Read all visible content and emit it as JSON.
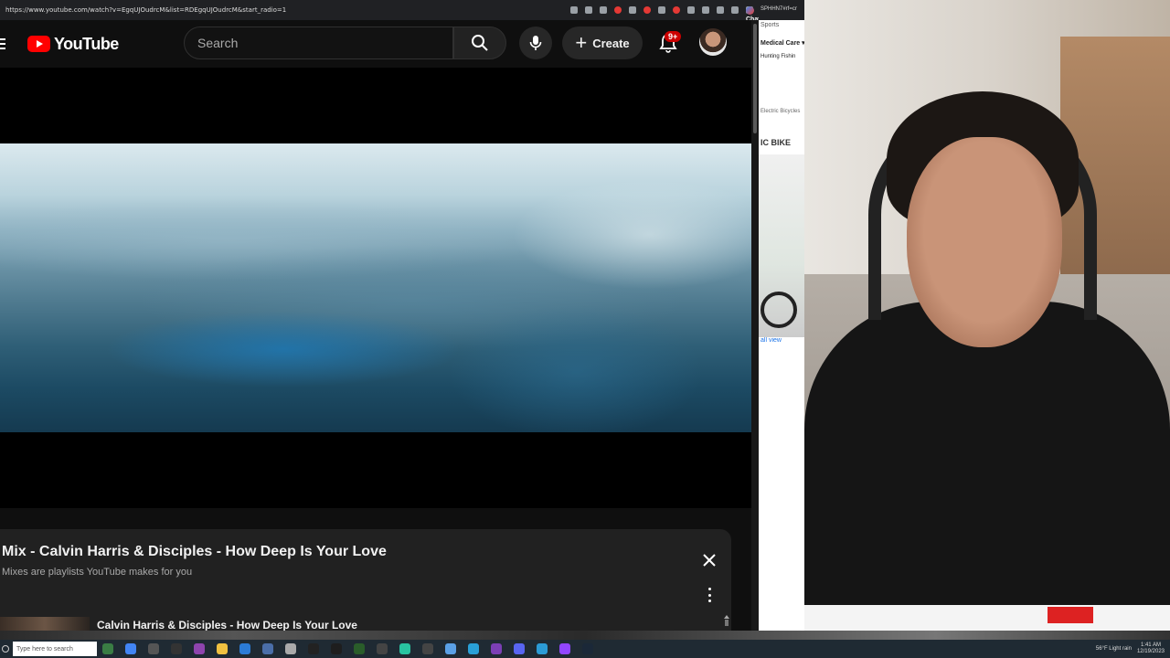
{
  "browser": {
    "url": "https://www.youtube.com/watch?v=EgqUJOudrcM&list=RDEgqUJOudrcM&start_radio=1",
    "chat_label": "Chat"
  },
  "header": {
    "logo_text": "YouTube",
    "search_placeholder": "Search",
    "create_label": "Create",
    "notification_count": "9+"
  },
  "mix": {
    "title": "Mix - Calvin Harris & Disciples - How Deep Is Your Love",
    "subtitle": "Mixes are playlists YouTube makes for you",
    "items": [
      {
        "title": "Calvin Harris & Disciples - How Deep Is Your Love"
      }
    ]
  },
  "side_browser": {
    "tab_text": "SPHHN7#rf=cr",
    "rows": [
      "Sports",
      "Medical Care ▾",
      "Hunting   Fishin",
      "Electric Bicycles"
    ],
    "banner": "IC BIKE",
    "link": "all view"
  },
  "taskbar": {
    "search_placeholder": "Type here to search",
    "weather": "56°F  Light rain",
    "time": "1:41 AM",
    "date": "12/19/2023"
  },
  "colors": {
    "youtube_red": "#ff0000",
    "background": "#0f0f0f",
    "panel": "#212121",
    "badge": "#cc0000"
  }
}
